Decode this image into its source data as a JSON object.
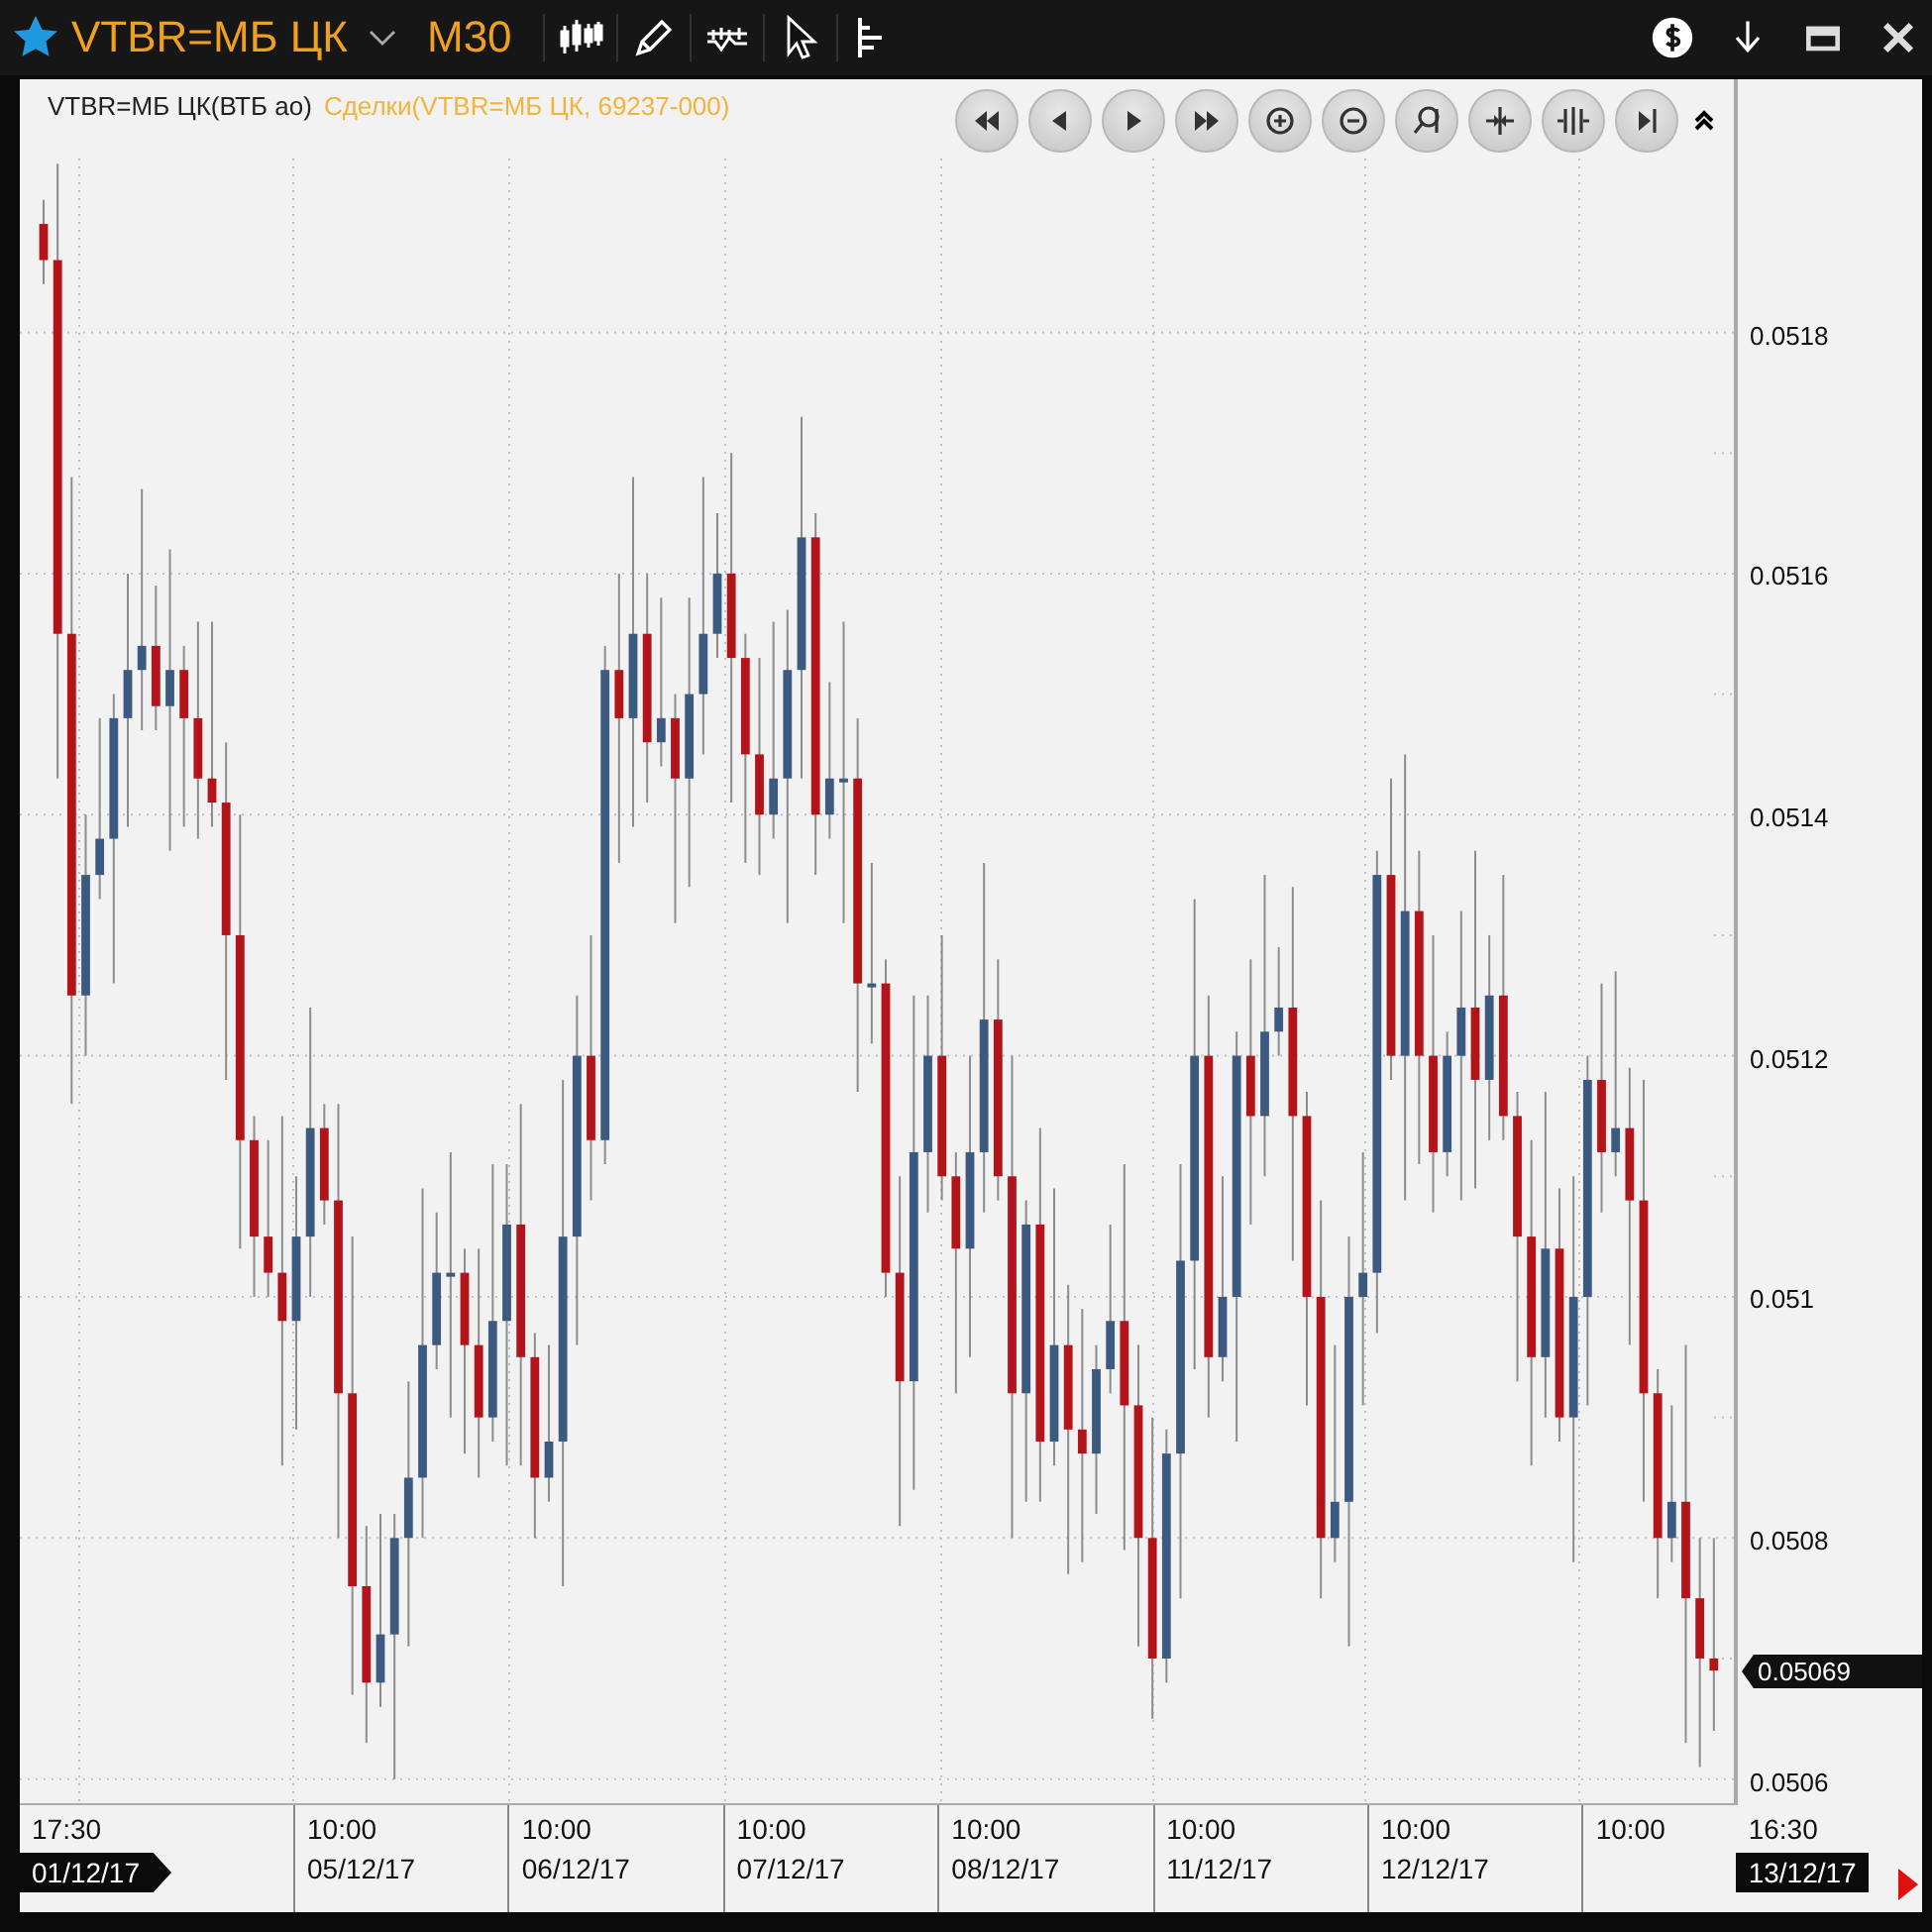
{
  "title_bar": {
    "symbol": "VTBR=МБ ЦК",
    "timeframe": "M30"
  },
  "chart": {
    "legend": {
      "instrument": "VTBR=МБ ЦК(ВТБ ао)",
      "series": "Сделки(VTBR=МБ ЦК, 69237-000)"
    },
    "chart_data": {
      "type": "candlestick",
      "grid": true,
      "ylim": [
        0.05058,
        0.05201
      ],
      "yticks": [
        {
          "value": 0.0518,
          "label": "0.0518"
        },
        {
          "value": 0.0516,
          "label": "0.0516"
        },
        {
          "value": 0.0514,
          "label": "0.0514"
        },
        {
          "value": 0.0512,
          "label": "0.0512"
        },
        {
          "value": 0.051,
          "label": "0.051"
        },
        {
          "value": 0.0508,
          "label": "0.0508"
        },
        {
          "value": 0.0506,
          "label": "0.0506"
        }
      ],
      "ohlc": [
        [
          0.05189,
          0.05191,
          0.05184,
          0.05186
        ],
        [
          0.05186,
          0.05194,
          0.05143,
          0.05155
        ],
        [
          0.05155,
          0.05168,
          0.05116,
          0.05125
        ],
        [
          0.05125,
          0.0514,
          0.0512,
          0.05135
        ],
        [
          0.05135,
          0.05148,
          0.05133,
          0.05138
        ],
        [
          0.05138,
          0.0515,
          0.05126,
          0.05148
        ],
        [
          0.05148,
          0.0516,
          0.05139,
          0.05152
        ],
        [
          0.05152,
          0.05167,
          0.05147,
          0.05154
        ],
        [
          0.05154,
          0.05159,
          0.05147,
          0.05149
        ],
        [
          0.05149,
          0.05162,
          0.05137,
          0.05152
        ],
        [
          0.05152,
          0.05154,
          0.05139,
          0.05148
        ],
        [
          0.05148,
          0.05156,
          0.05138,
          0.05143
        ],
        [
          0.05143,
          0.05156,
          0.05139,
          0.05141
        ],
        [
          0.05141,
          0.05146,
          0.05118,
          0.0513
        ],
        [
          0.0513,
          0.0514,
          0.05104,
          0.05113
        ],
        [
          0.05113,
          0.05115,
          0.051,
          0.05105
        ],
        [
          0.05105,
          0.05113,
          0.051,
          0.05102
        ],
        [
          0.05102,
          0.05115,
          0.05086,
          0.05098
        ],
        [
          0.05098,
          0.0511,
          0.05089,
          0.05105
        ],
        [
          0.05105,
          0.05124,
          0.051,
          0.05114
        ],
        [
          0.05114,
          0.05116,
          0.05106,
          0.05108
        ],
        [
          0.05108,
          0.05116,
          0.0508,
          0.05092
        ],
        [
          0.05092,
          0.05105,
          0.05067,
          0.05076
        ],
        [
          0.05076,
          0.05081,
          0.05063,
          0.05068
        ],
        [
          0.05068,
          0.05082,
          0.05066,
          0.05072
        ],
        [
          0.05072,
          0.05082,
          0.0506,
          0.0508
        ],
        [
          0.0508,
          0.05093,
          0.05071,
          0.05085
        ],
        [
          0.05085,
          0.05109,
          0.0508,
          0.05096
        ],
        [
          0.05096,
          0.05107,
          0.05094,
          0.05102
        ],
        [
          0.05102,
          0.05112,
          0.0509,
          0.05102
        ],
        [
          0.05102,
          0.05104,
          0.05087,
          0.05096
        ],
        [
          0.05096,
          0.05104,
          0.05085,
          0.0509
        ],
        [
          0.0509,
          0.05111,
          0.05088,
          0.05098
        ],
        [
          0.05098,
          0.05111,
          0.05086,
          0.05106
        ],
        [
          0.05106,
          0.05116,
          0.05086,
          0.05095
        ],
        [
          0.05095,
          0.05097,
          0.0508,
          0.05085
        ],
        [
          0.05085,
          0.05096,
          0.05083,
          0.05088
        ],
        [
          0.05088,
          0.05118,
          0.05076,
          0.05105
        ],
        [
          0.05105,
          0.05125,
          0.05096,
          0.0512
        ],
        [
          0.0512,
          0.0513,
          0.05108,
          0.05113
        ],
        [
          0.05113,
          0.05154,
          0.05111,
          0.05152
        ],
        [
          0.05152,
          0.0516,
          0.05136,
          0.05148
        ],
        [
          0.05148,
          0.05168,
          0.05139,
          0.05155
        ],
        [
          0.05155,
          0.0516,
          0.05141,
          0.05146
        ],
        [
          0.05146,
          0.05158,
          0.05144,
          0.05148
        ],
        [
          0.05148,
          0.0515,
          0.05131,
          0.05143
        ],
        [
          0.05143,
          0.05158,
          0.05134,
          0.0515
        ],
        [
          0.0515,
          0.05168,
          0.05145,
          0.05155
        ],
        [
          0.05155,
          0.05165,
          0.05153,
          0.0516
        ],
        [
          0.0516,
          0.0517,
          0.05141,
          0.05153
        ],
        [
          0.05153,
          0.05155,
          0.05136,
          0.05145
        ],
        [
          0.05145,
          0.05153,
          0.05135,
          0.0514
        ],
        [
          0.0514,
          0.05156,
          0.05138,
          0.05143
        ],
        [
          0.05143,
          0.05157,
          0.05131,
          0.05152
        ],
        [
          0.05152,
          0.05173,
          0.05143,
          0.05163
        ],
        [
          0.05163,
          0.05165,
          0.05135,
          0.0514
        ],
        [
          0.0514,
          0.05151,
          0.05138,
          0.05143
        ],
        [
          0.05143,
          0.05156,
          0.05131,
          0.05143
        ],
        [
          0.05143,
          0.05148,
          0.05117,
          0.05126
        ],
        [
          0.05126,
          0.05136,
          0.05121,
          0.05126
        ],
        [
          0.05126,
          0.05128,
          0.051,
          0.05102
        ],
        [
          0.05102,
          0.0511,
          0.05081,
          0.05093
        ],
        [
          0.05093,
          0.05125,
          0.05084,
          0.05112
        ],
        [
          0.05112,
          0.05125,
          0.05107,
          0.0512
        ],
        [
          0.0512,
          0.0513,
          0.05108,
          0.0511
        ],
        [
          0.0511,
          0.05112,
          0.05092,
          0.05104
        ],
        [
          0.05104,
          0.0512,
          0.05095,
          0.05112
        ],
        [
          0.05112,
          0.05136,
          0.05107,
          0.05123
        ],
        [
          0.05123,
          0.05128,
          0.05108,
          0.0511
        ],
        [
          0.0511,
          0.0512,
          0.0508,
          0.05092
        ],
        [
          0.05092,
          0.05108,
          0.05083,
          0.05106
        ],
        [
          0.05106,
          0.05114,
          0.05083,
          0.05088
        ],
        [
          0.05088,
          0.05109,
          0.05086,
          0.05096
        ],
        [
          0.05096,
          0.05101,
          0.05077,
          0.05089
        ],
        [
          0.05089,
          0.05099,
          0.05078,
          0.05087
        ],
        [
          0.05087,
          0.05096,
          0.05082,
          0.05094
        ],
        [
          0.05094,
          0.05106,
          0.05092,
          0.05098
        ],
        [
          0.05098,
          0.05111,
          0.05079,
          0.05091
        ],
        [
          0.05091,
          0.05096,
          0.05071,
          0.0508
        ],
        [
          0.0508,
          0.0509,
          0.05065,
          0.0507
        ],
        [
          0.0507,
          0.05089,
          0.05068,
          0.05087
        ],
        [
          0.05087,
          0.05111,
          0.05075,
          0.05103
        ],
        [
          0.05103,
          0.05133,
          0.05094,
          0.0512
        ],
        [
          0.0512,
          0.05125,
          0.0509,
          0.05095
        ],
        [
          0.05095,
          0.0511,
          0.05093,
          0.051
        ],
        [
          0.051,
          0.05122,
          0.05088,
          0.0512
        ],
        [
          0.0512,
          0.05128,
          0.05106,
          0.05115
        ],
        [
          0.05115,
          0.05135,
          0.0511,
          0.05122
        ],
        [
          0.05122,
          0.05129,
          0.0512,
          0.05124
        ],
        [
          0.05124,
          0.05134,
          0.05103,
          0.05115
        ],
        [
          0.05115,
          0.05117,
          0.05091,
          0.051
        ],
        [
          0.051,
          0.05108,
          0.05075,
          0.0508
        ],
        [
          0.0508,
          0.05096,
          0.05078,
          0.05083
        ],
        [
          0.05083,
          0.05105,
          0.05071,
          0.051
        ],
        [
          0.051,
          0.05112,
          0.05091,
          0.05102
        ],
        [
          0.05102,
          0.05137,
          0.05097,
          0.05135
        ],
        [
          0.05135,
          0.05143,
          0.05118,
          0.0512
        ],
        [
          0.0512,
          0.05145,
          0.05108,
          0.05132
        ],
        [
          0.05132,
          0.05137,
          0.05111,
          0.0512
        ],
        [
          0.0512,
          0.0513,
          0.05107,
          0.05112
        ],
        [
          0.05112,
          0.05122,
          0.0511,
          0.0512
        ],
        [
          0.0512,
          0.05132,
          0.05108,
          0.05124
        ],
        [
          0.05124,
          0.05137,
          0.05109,
          0.05118
        ],
        [
          0.05118,
          0.0513,
          0.05113,
          0.05125
        ],
        [
          0.05125,
          0.05135,
          0.05113,
          0.05115
        ],
        [
          0.05115,
          0.05117,
          0.05093,
          0.05105
        ],
        [
          0.05105,
          0.05113,
          0.05086,
          0.05095
        ],
        [
          0.05095,
          0.05117,
          0.0509,
          0.05104
        ],
        [
          0.05104,
          0.05109,
          0.05088,
          0.0509
        ],
        [
          0.0509,
          0.0511,
          0.05078,
          0.051
        ],
        [
          0.051,
          0.0512,
          0.05091,
          0.05118
        ],
        [
          0.05118,
          0.05126,
          0.05107,
          0.05112
        ],
        [
          0.05112,
          0.05127,
          0.0511,
          0.05114
        ],
        [
          0.05114,
          0.05119,
          0.05096,
          0.05108
        ],
        [
          0.05108,
          0.05118,
          0.05083,
          0.05092
        ],
        [
          0.05092,
          0.05094,
          0.05075,
          0.0508
        ],
        [
          0.0508,
          0.05091,
          0.05078,
          0.05083
        ],
        [
          0.05083,
          0.05096,
          0.05063,
          0.05075
        ],
        [
          0.05075,
          0.0508,
          0.05061,
          0.0507
        ],
        [
          0.0507,
          0.0508,
          0.05064,
          0.05069
        ]
      ]
    },
    "current_price": "0.05069",
    "time_axis": [
      {
        "kind": "start",
        "time": "17:30",
        "date": "01/12/17"
      },
      {
        "kind": "day",
        "time": "10:00",
        "date": "05/12/17"
      },
      {
        "kind": "day",
        "time": "10:00",
        "date": "06/12/17"
      },
      {
        "kind": "day",
        "time": "10:00",
        "date": "07/12/17"
      },
      {
        "kind": "day",
        "time": "10:00",
        "date": "08/12/17"
      },
      {
        "kind": "day",
        "time": "10:00",
        "date": "11/12/17"
      },
      {
        "kind": "day",
        "time": "10:00",
        "date": "12/12/17"
      },
      {
        "kind": "day",
        "time": "10:00"
      },
      {
        "kind": "end",
        "time": "16:30",
        "date": "13/12/17"
      }
    ]
  }
}
